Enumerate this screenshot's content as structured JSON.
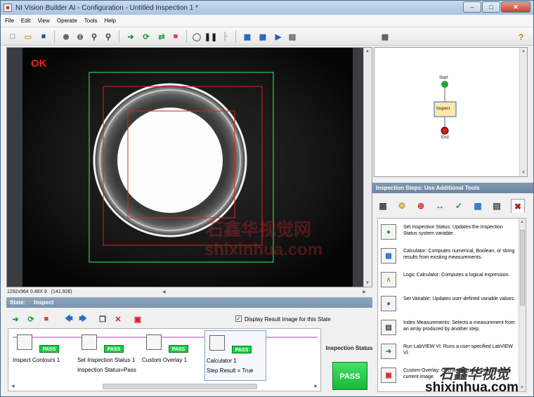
{
  "window": {
    "title": "NI Vision Builder AI - Configuration - Untitled Inspection 1 *"
  },
  "menu": [
    "File",
    "Edit",
    "View",
    "Operate",
    "Tools",
    "Help"
  ],
  "viewer": {
    "result": "OK",
    "image_info": "1292x964 0.48X 9",
    "cursor": "(141,926)"
  },
  "state": {
    "label": "State:",
    "name": "Inspect"
  },
  "display_result": {
    "checked": true,
    "label": "Display Result Image for this State"
  },
  "steps": [
    {
      "name": "Inspect Contours 1",
      "result": "PASS",
      "subtext": ""
    },
    {
      "name": "Set Inspection Status 1",
      "result": "PASS",
      "subtext": "Inspection Status=Pass"
    },
    {
      "name": "Custom Overlay 1",
      "result": "PASS",
      "subtext": ""
    },
    {
      "name": "Calculator 1",
      "result": "PASS",
      "subtext": "Step Result = True"
    }
  ],
  "inspection_status": {
    "label": "Inspection Status",
    "value": "PASS"
  },
  "diagram": {
    "start": "Start",
    "inspect": "Inspect",
    "end": "End"
  },
  "inspection_steps": {
    "header": "Inspection Steps: Use Additional Tools",
    "tools": [
      {
        "text": "Set Inspection Status: Updates the Inspection Status system variable."
      },
      {
        "text": "Calculator: Computes numerical, Boolean, or string results from existing measurements."
      },
      {
        "text": "Logic Calculator: Computes a logical expression."
      },
      {
        "text": "Set Variable: Updates user-defined variable values."
      },
      {
        "text": "Index Measurements: Selects a measurement from an array produced by another step."
      },
      {
        "text": "Run LabVIEW VI: Runs a user-specified LabVIEW VI."
      },
      {
        "text": "Custom Overlay: Overlays custom data onto the current image."
      }
    ]
  },
  "watermark": {
    "cn": "石鑫华视觉网",
    "url": "shixinhua.com",
    "cn2": "石鑫华视觉",
    "url2": "shixinhua.com"
  },
  "colors": {
    "pass": "#18d03f",
    "ok": "#ff1a1a",
    "header": "#7a94b0"
  }
}
